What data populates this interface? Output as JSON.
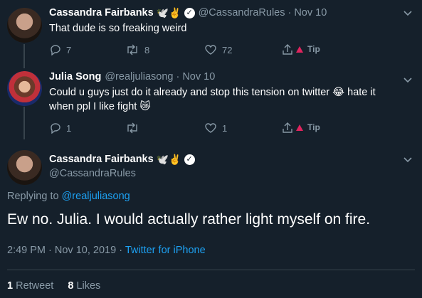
{
  "tweet1": {
    "name": "Cassandra Fairbanks",
    "badges": "🕊️✌️",
    "handle": "@CassandraRules",
    "dot": "·",
    "date": "Nov 10",
    "text": "That dude is so freaking weird",
    "reply_count": "7",
    "retweet_count": "8",
    "like_count": "72",
    "tip_label": "Tip"
  },
  "tweet2": {
    "name": "Julia Song",
    "handle": "@realjuliasong",
    "dot": "·",
    "date": "Nov 10",
    "text_line1": "Could u guys just do it already and stop this tension on twitter 😂 hate it",
    "text_line2": "when ppl I like fight 😿",
    "reply_count": "1",
    "retweet_count": "",
    "like_count": "1",
    "tip_label": "Tip"
  },
  "main": {
    "name": "Cassandra Fairbanks",
    "badges": "🕊️✌️",
    "handle": "@CassandraRules",
    "replying_prefix": "Replying to",
    "replying_handle": "@realjuliasong",
    "text": "Ew no. Julia. I would actually rather light myself on fire.",
    "time": "2:49 PM · Nov 10, 2019",
    "dot": "·",
    "source": "Twitter for iPhone",
    "retweets_count": "1",
    "retweets_label": "Retweet",
    "likes_count": "8",
    "likes_label": "Likes"
  },
  "icons": {
    "chevron": "chevron-down-icon",
    "verified": "verified-badge-icon",
    "reply": "reply-icon",
    "retweet": "retweet-icon",
    "like": "heart-icon",
    "share": "share-icon",
    "tip": "tip-icon"
  },
  "colors": {
    "background": "#15202b",
    "muted": "#8899a6",
    "accent": "#1da1f2",
    "divider": "#38444d",
    "tip": "#e0245e"
  }
}
